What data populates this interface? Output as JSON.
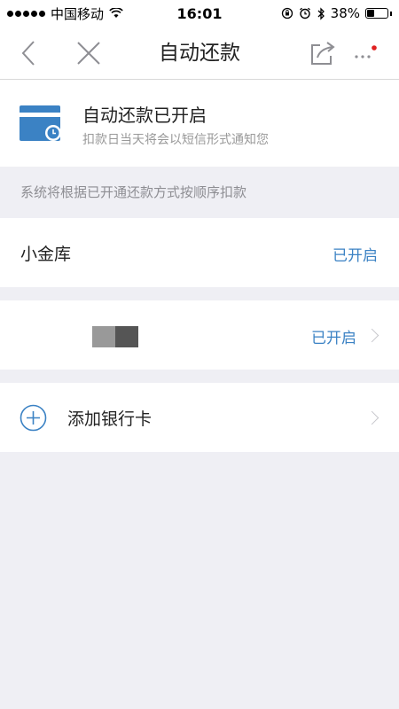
{
  "status_bar": {
    "carrier": "中国移动",
    "time": "16:01",
    "battery_percent": "38%",
    "battery_level": 0.38
  },
  "nav": {
    "title": "自动还款"
  },
  "banner": {
    "title": "自动还款已开启",
    "subtitle": "扣款日当天将会以短信形式通知您"
  },
  "hint": "系统将根据已开通还款方式按顺序扣款",
  "methods": [
    {
      "label": "小金库",
      "status": "已开启"
    },
    {
      "label": "",
      "status": "已开启"
    }
  ],
  "add_card": {
    "label": "添加银行卡"
  },
  "colors": {
    "accent": "#3b82c4",
    "background": "#efeff4",
    "notify_dot": "#e02020"
  }
}
